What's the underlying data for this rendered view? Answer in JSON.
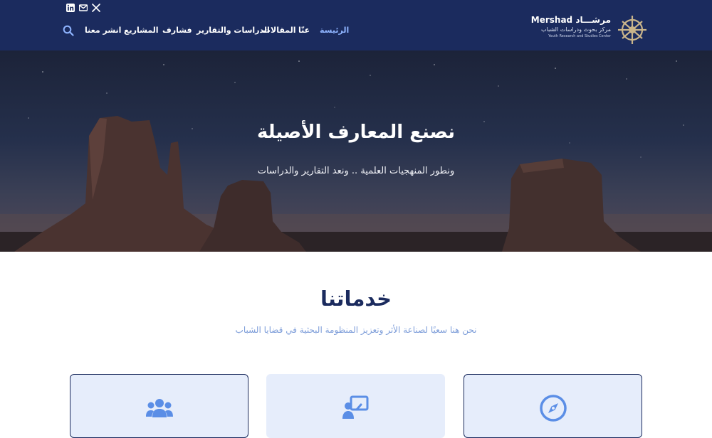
{
  "brand": {
    "name_latin": "Mershad",
    "name_arabic": "مرشـــاد",
    "subtitle_arabic": "مركز بحوث ودراسات الشباب",
    "subtitle_english": "Youth Research and Studies Center"
  },
  "nav": {
    "items": [
      {
        "label": "الرئيسة",
        "active": true
      },
      {
        "label": "عنّا",
        "active": false
      },
      {
        "label": "المقالات",
        "active": false
      },
      {
        "label": "الدراسات والتقارير",
        "active": false
      },
      {
        "label": "فشارف",
        "active": false
      },
      {
        "label": "المشاريع",
        "active": false
      },
      {
        "label": "انشر معنا",
        "active": false
      }
    ],
    "search_icon": "search-icon"
  },
  "social": [
    "linkedin-icon",
    "mail-icon",
    "x-icon"
  ],
  "hero": {
    "title": "نصنع المعارف الأصيلة",
    "subtitle": "ونطور المنهجيات العلمية .. ونعد التقارير والدراسات"
  },
  "services": {
    "title": "خدماتنا",
    "subtitle": "نحن هنا سعيًا لصناعة الأثر وتعزيز المنظومة البحثية في قضايا الشباب",
    "cards": [
      {
        "icon": "compass-icon"
      },
      {
        "icon": "presentation-icon"
      },
      {
        "icon": "users-icon"
      }
    ]
  },
  "colors": {
    "header_bg": "#1b2b5e",
    "accent": "#8fb4ff",
    "card_bg": "#e6edfb",
    "icon_blue": "#5b8ee6",
    "title_navy": "#1b2b5e"
  }
}
